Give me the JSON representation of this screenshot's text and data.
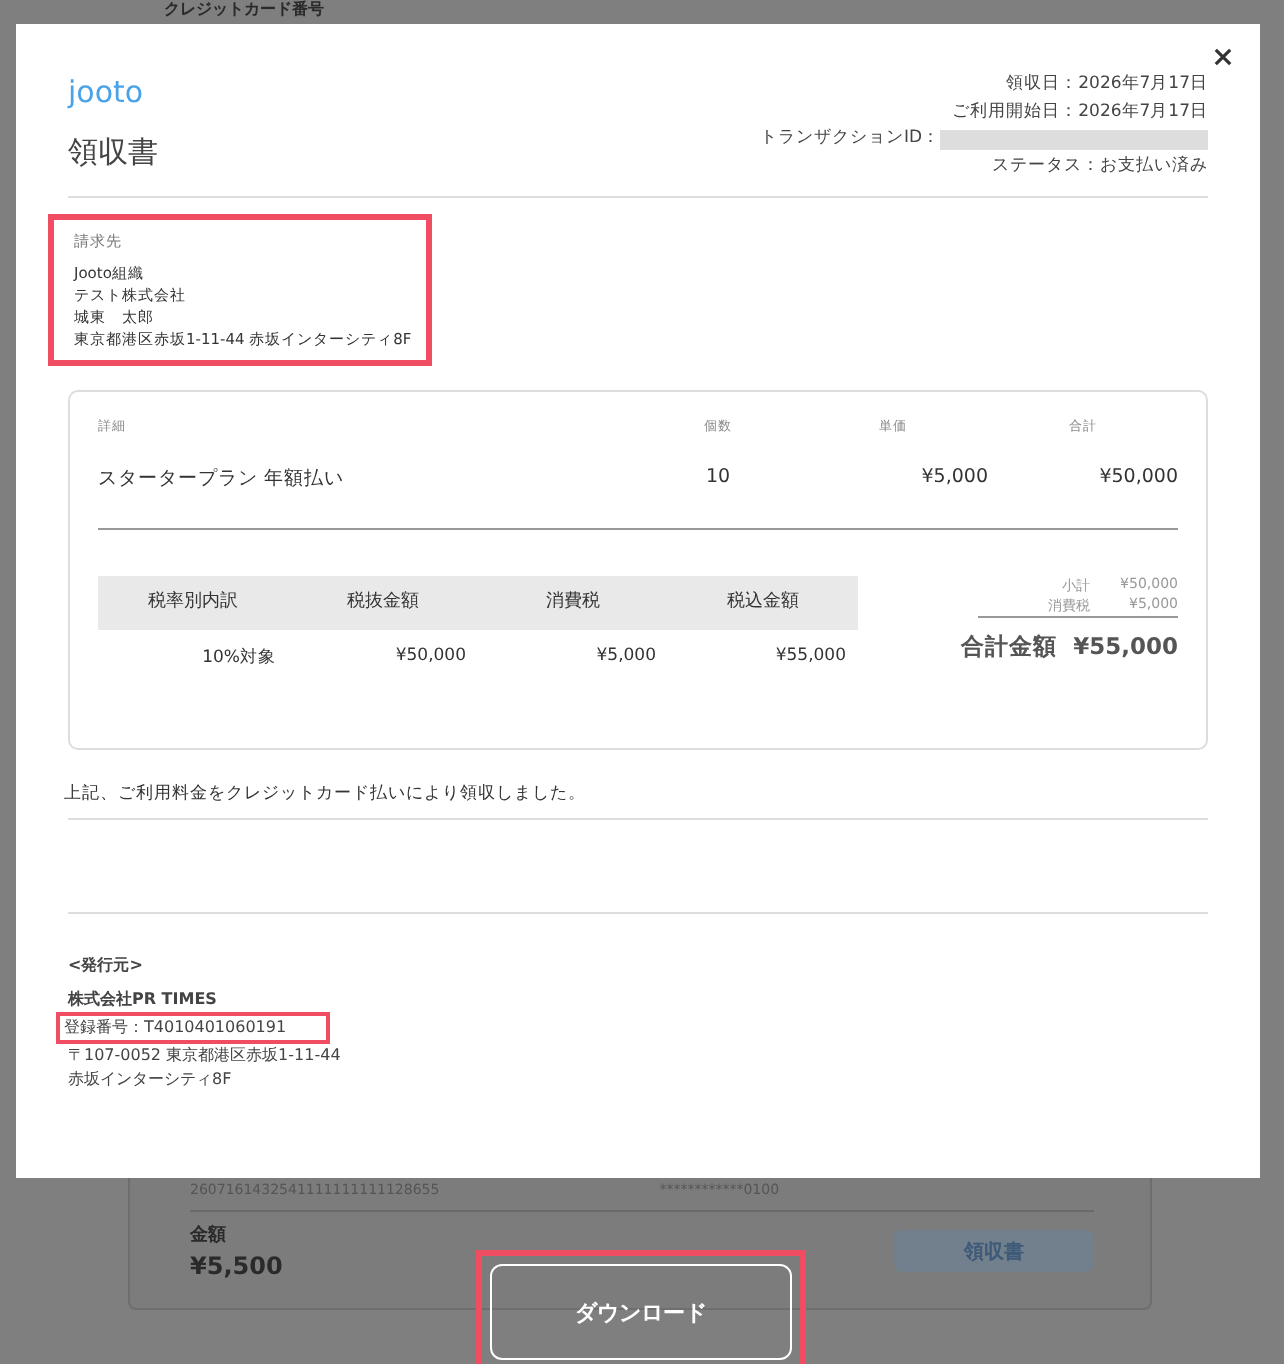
{
  "background_page": {
    "header_label": "クレジットカード番号",
    "transaction_number": "2607161432541111111111128655",
    "card_number": "************0100",
    "amount_label": "金額",
    "amount": "¥5,500",
    "receipt_button": "領収書"
  },
  "modal": {
    "logo": "jooto",
    "title": "領収書",
    "meta": [
      {
        "kind": "text",
        "label": "領収日：",
        "value": "2026年7月17日"
      },
      {
        "kind": "text",
        "label": "ご利用開始日：",
        "value": "2026年7月17日"
      },
      {
        "kind": "redacted",
        "label": "トランザクションID："
      },
      {
        "kind": "text",
        "label": "ステータス：",
        "value": "お支払い済み"
      }
    ],
    "bill_to": {
      "heading": "請求先",
      "highlighted": true,
      "lines": [
        "Jooto組織",
        "テスト株式会社",
        "城東　太郎",
        "東京都港区赤坂1-11-44 赤坂インターシティ8F"
      ]
    },
    "items": {
      "columns": [
        "詳細",
        "個数",
        "単価",
        "合計"
      ],
      "rows": [
        [
          "スタータープラン 年額払い",
          "10",
          "¥5,000",
          "¥50,000"
        ]
      ]
    },
    "tax_table": {
      "columns": [
        "税率別内訳",
        "税抜金額",
        "消費税",
        "税込金額"
      ],
      "rows": [
        [
          "10%対象",
          "¥50,000",
          "¥5,000",
          "¥55,000"
        ]
      ]
    },
    "summary": [
      {
        "label": "小計",
        "value": "¥50,000"
      },
      {
        "label": "消費税",
        "value": "¥5,000"
      }
    ],
    "total": {
      "label": "合計金額",
      "value": "¥55,000"
    },
    "note": "上記、ご利用料金をクレジットカード払いにより領収しました。",
    "issuer": {
      "heading": "<発行元>",
      "company": "株式会社PR TIMES",
      "registration": "登録番号：T4010401060191",
      "registration_highlighted": true,
      "address": [
        "〒107-0052 東京都港区赤坂1-11-44",
        "赤坂インターシティ8F"
      ]
    }
  },
  "download_button": {
    "label": "ダウンロード",
    "highlighted": true
  }
}
